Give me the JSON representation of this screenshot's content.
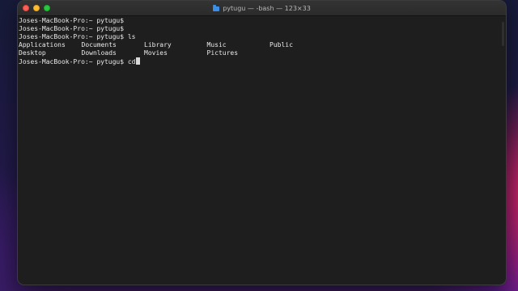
{
  "window": {
    "title": "pytugu — -bash — 123×33",
    "title_icon": "folder-icon",
    "controls": [
      "close",
      "minimize",
      "zoom"
    ]
  },
  "terminal": {
    "lines": [
      "Joses-MacBook-Pro:~ pytugu$",
      "Joses-MacBook-Pro:~ pytugu$",
      "Joses-MacBook-Pro:~ pytugu$ ls"
    ],
    "ls_output": [
      [
        "Applications",
        "Documents",
        "Library",
        "Music",
        "Public"
      ],
      [
        "Desktop",
        "Downloads",
        "Movies",
        "Pictures"
      ]
    ],
    "current_prompt": "Joses-MacBook-Pro:~ pytugu$ ",
    "current_input": "cd"
  },
  "colors": {
    "terminal_bg": "#1e1e1e",
    "terminal_fg": "#e9e9e9",
    "close": "#fe5f57",
    "minimize": "#febc2e",
    "zoom": "#28c840",
    "folder_icon": "#3b8ee8"
  }
}
